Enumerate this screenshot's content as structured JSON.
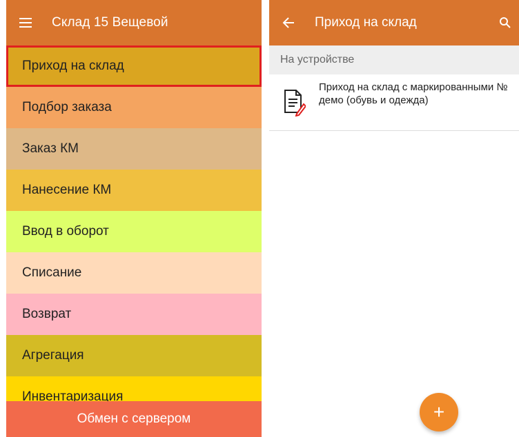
{
  "left": {
    "title": "Склад 15 Вещевой",
    "operations": [
      {
        "label": "Приход на склад",
        "color": "#DAA520",
        "selected": true
      },
      {
        "label": "Подбор заказа",
        "color": "#F4A460"
      },
      {
        "label": "Заказ КМ",
        "color": "#DEB887"
      },
      {
        "label": "Нанесение КМ",
        "color": "#F0C040"
      },
      {
        "label": "Ввод в оборот",
        "color": "#DEFF6A"
      },
      {
        "label": "Списание",
        "color": "#FFDAB9"
      },
      {
        "label": "Возврат",
        "color": "#FFB6C1"
      },
      {
        "label": "Агрегация",
        "color": "#D4BB25"
      },
      {
        "label": "Инвентаризация",
        "color": "#FFD700"
      }
    ],
    "footer": "Обмен с сервером"
  },
  "right": {
    "title": "Приход на склад",
    "section": "На устройстве",
    "doc": "Приход на склад с маркированными № демо (обувь и одежда)",
    "fab": "+"
  },
  "colors": {
    "appbar": "#D9752E",
    "footer": "#F26A4B",
    "fab": "#F08A29",
    "highlight": "#E0201F"
  },
  "icons": [
    "menu-icon",
    "back-arrow-icon",
    "search-icon",
    "document-edit-icon",
    "add-icon"
  ]
}
